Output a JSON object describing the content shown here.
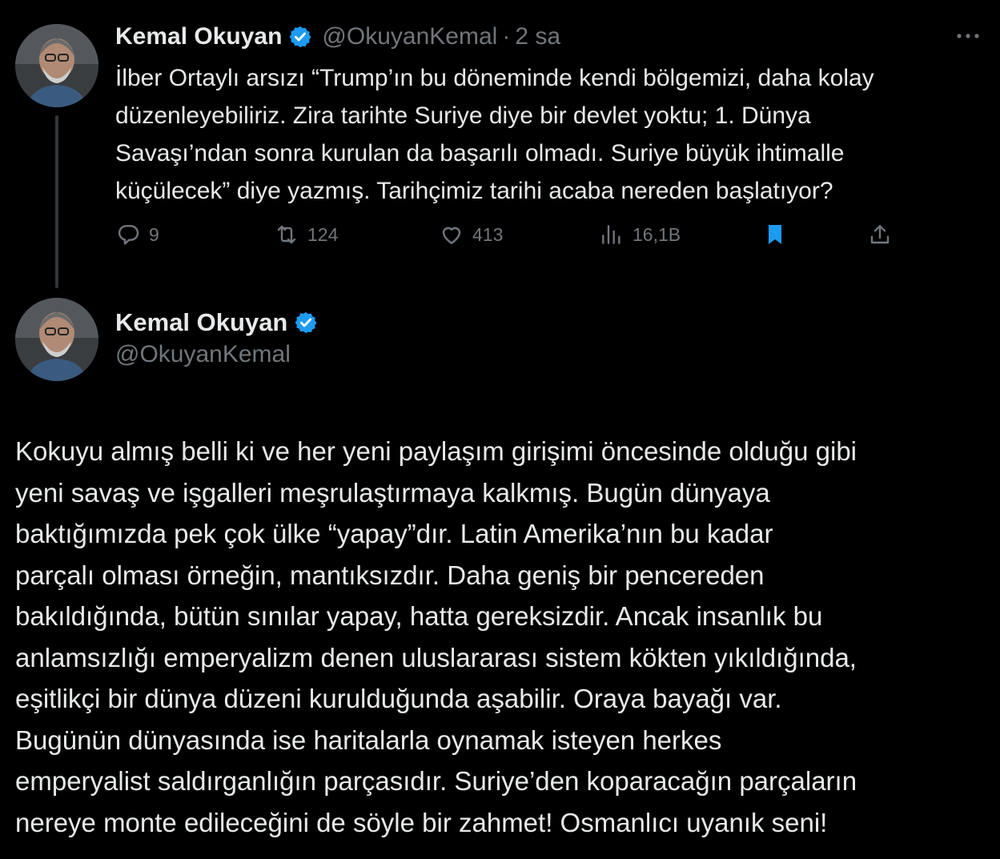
{
  "colors": {
    "background": "#000000",
    "text": "#e7e9ea",
    "muted": "#71767b",
    "accent": "#1d9bf0",
    "thread_line": "#333639"
  },
  "parent_tweet": {
    "author_name": "Kemal Okuyan",
    "author_handle": "@OkuyanKemal",
    "separator": "·",
    "timestamp": "2 sa",
    "verified_icon": "verified-badge-icon",
    "more_icon": "more-options-icon",
    "text": "İlber Ortaylı arsızı “Trump’ın bu döneminde kendi bölgemizi, daha kolay\ndüzenleyebiliriz. Zira tarihte Suriye diye bir devlet yoktu; 1. Dünya\nSavaşı’ndan sonra kurulan da başarılı olmadı. Suriye büyük ihtimalle\nküçülecek” diye yazmış. Tarihçimiz tarihi acaba nereden başlatıyor?",
    "actions": {
      "reply": {
        "icon": "reply-icon",
        "count": "9"
      },
      "retweet": {
        "icon": "retweet-icon",
        "count": "124"
      },
      "like": {
        "icon": "heart-icon",
        "count": "413"
      },
      "views": {
        "icon": "views-chart-icon",
        "count": "16,1B"
      },
      "bookmark": {
        "icon": "bookmark-icon",
        "active": true
      },
      "share": {
        "icon": "share-icon"
      }
    }
  },
  "main_tweet": {
    "author_name": "Kemal Okuyan",
    "author_handle": "@OkuyanKemal",
    "verified_icon": "verified-badge-icon",
    "text": "Kokuyu almış belli ki ve her yeni paylaşım girişimi öncesinde olduğu gibi\nyeni savaş ve işgalleri meşrulaştırmaya kalkmış. Bugün dünyaya\nbaktığımızda pek çok ülke “yapay”dır. Latin Amerika’nın bu kadar\nparçalı olması örneğin, mantıksızdır. Daha geniş bir pencereden\nbakıldığında, bütün sınılar yapay, hatta gereksizdir. Ancak insanlık bu\nanlamsızlığı emperyalizm denen uluslararası sistem kökten yıkıldığında,\neşitlikçi bir dünya düzeni kurulduğunda aşabilir. Oraya bayağı var.\nBugünün dünyasında ise haritalarla oynamak isteyen herkes\nemperyalist saldırganlığın parçasıdır. Suriye’den koparacağın parçaların\nnereye monte edileceğini de söyle bir zahmet! Osmanlıcı uyanık seni!"
  }
}
